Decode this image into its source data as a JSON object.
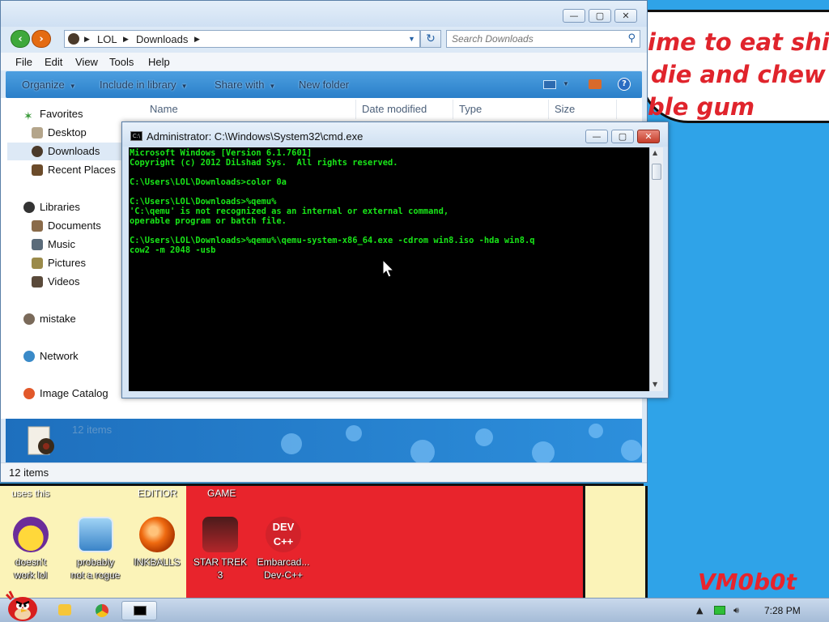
{
  "wallpaper": {
    "text_lines": [
      "ime to eat shi",
      "die and chew",
      "ble gum"
    ],
    "labels": {
      "uses_this": "uses this",
      "editor": "EDITIOR",
      "game": "GAME"
    },
    "watermark": "VM0b0t"
  },
  "desktop_icons": [
    {
      "name": "yahoo-messenger-icon",
      "label_1": "doesn't",
      "label_2": "work lol"
    },
    {
      "name": "network-computer-icon",
      "label_1": "probably",
      "label_2": "not a rogue"
    },
    {
      "name": "inkballs-icon",
      "label_1": "INKBALLS",
      "label_2": ""
    },
    {
      "name": "star-trek-icon",
      "label_1": "STAR TREK",
      "label_2": "3"
    },
    {
      "name": "dev-cpp-icon",
      "label_1": "Embarcad...",
      "label_2": "Dev-C++"
    }
  ],
  "explorer": {
    "breadcrumb": [
      "LOL",
      "Downloads"
    ],
    "search_placeholder": "Search Downloads",
    "menu": [
      "File",
      "Edit",
      "View",
      "Tools",
      "Help"
    ],
    "toolbar": {
      "organize": "Organize",
      "include": "Include in library",
      "share": "Share with",
      "new_folder": "New folder"
    },
    "nav": {
      "favorites": "Favorites",
      "desktop": "Desktop",
      "downloads": "Downloads",
      "recent": "Recent Places",
      "libraries": "Libraries",
      "documents": "Documents",
      "music": "Music",
      "pictures": "Pictures",
      "videos": "Videos",
      "user": "mistake",
      "network": "Network",
      "image_catalog": "Image Catalog"
    },
    "columns": {
      "name": "Name",
      "date": "Date modified",
      "type": "Type",
      "size": "Size"
    },
    "details_count": "12 items",
    "status_count": "12 items",
    "window_buttons": {
      "min": "—",
      "max": "▢",
      "close": "✕"
    }
  },
  "cmd": {
    "title": "Administrator: C:\\Windows\\System32\\cmd.exe",
    "console_text": "Microsoft Windows [Version 6.1.7601]\nCopyright (c) 2012 DiLshad Sys.  All rights reserved.\n\nC:\\Users\\LOL\\Downloads>color 0a\n\nC:\\Users\\LOL\\Downloads>%qemu%\n'C:\\qemu' is not recognized as an internal or external command,\noperable program or batch file.\n\nC:\\Users\\LOL\\Downloads>%qemu%\\qemu-system-x86_64.exe -cdrom win8.iso -hda win8.q\ncow2 -m 2048 -usb",
    "text_color": "#19e619"
  },
  "taskbar": {
    "time": "7:28 PM"
  }
}
